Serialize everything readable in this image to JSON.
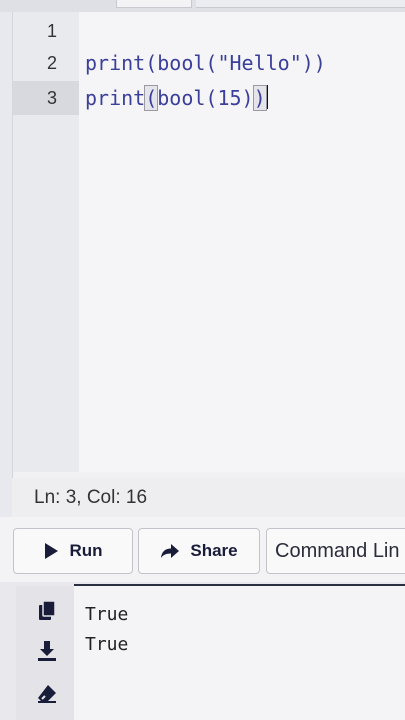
{
  "editor": {
    "lines": [
      {
        "number": "1",
        "code": ""
      },
      {
        "number": "2",
        "code": "print(bool(\"Hello\"))"
      },
      {
        "number": "3",
        "code_parts": [
          "print",
          "(",
          "bool(15)",
          ")"
        ]
      }
    ],
    "active_line": 3
  },
  "status": {
    "position": "Ln: 3,  Col: 16"
  },
  "toolbar": {
    "run_label": "Run",
    "share_label": "Share",
    "command_line_label": "Command Lin"
  },
  "output": {
    "lines": [
      "True",
      "True"
    ]
  },
  "icons": {
    "run": "play-icon",
    "share": "share-arrow-icon",
    "copy": "copy-icon",
    "download": "download-icon",
    "clear": "eraser-icon"
  }
}
